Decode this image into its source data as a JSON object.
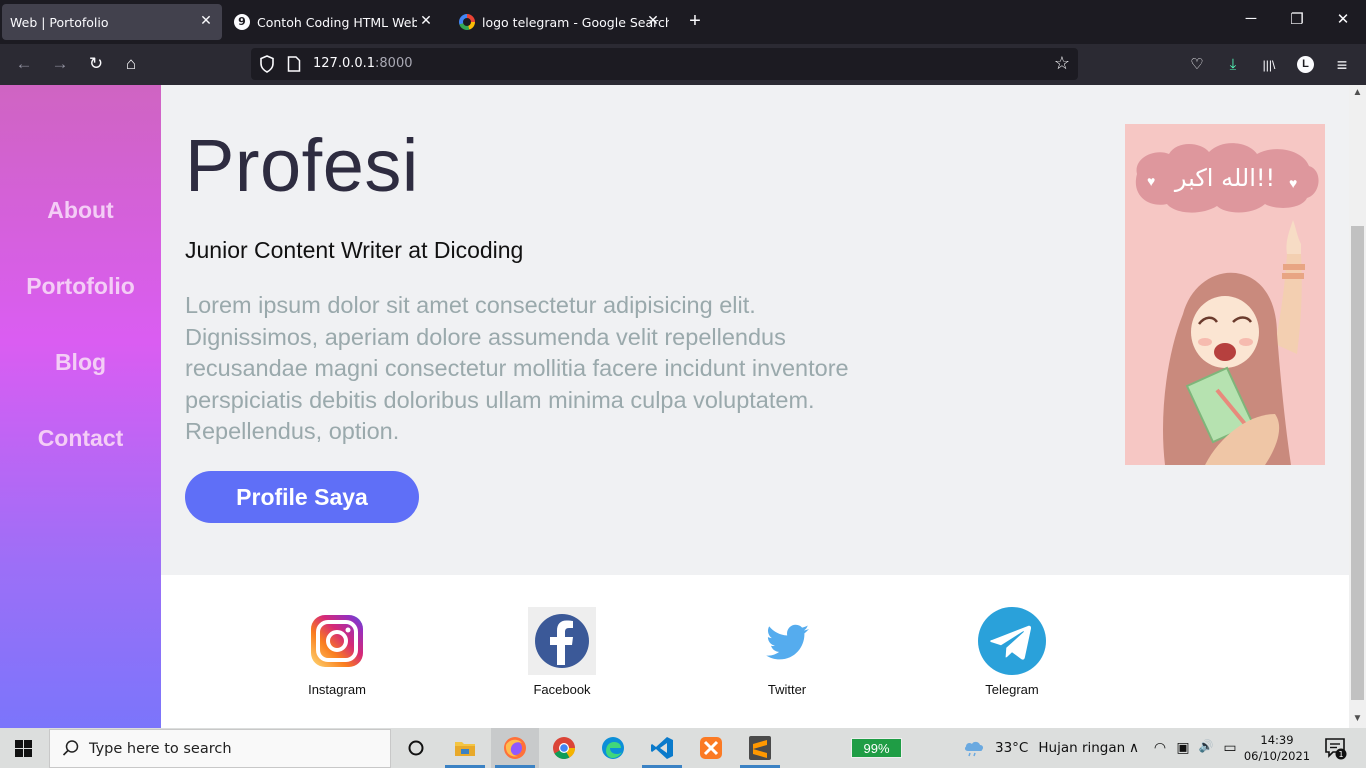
{
  "browser": {
    "tabs": [
      {
        "title": "Web | Portofolio",
        "active": true
      },
      {
        "title": "Contoh Coding HTML Website Po",
        "favicon": "9",
        "active": false
      },
      {
        "title": "logo telegram - Google Search",
        "active": false
      }
    ],
    "close_glyph": "✕",
    "new_tab_glyph": "+",
    "window": {
      "minimize": "─",
      "restore": "❐",
      "close": "✕"
    },
    "nav": {
      "back": "←",
      "forward": "→",
      "reload": "↻",
      "home": "⌂"
    },
    "url": {
      "host": "127.0.0.1",
      "port": ":8000"
    },
    "bookmark_star": "☆",
    "toolbar": {
      "pocket": "♡",
      "downloads": "⤓",
      "library": "|||\\",
      "account": "L",
      "menu": "≡"
    }
  },
  "page": {
    "sidebar": {
      "links": [
        "About",
        "Portofolio",
        "Blog",
        "Contact"
      ]
    },
    "hero": {
      "title": "Profesi",
      "subtitle": "Junior Content Writer at Dicoding",
      "paragraph": "Lorem ipsum dolor sit amet consectetur adipisicing elit. Dignissimos, aperiam dolore assumenda velit repellendus recusandae magni consectetur mollitia facere incidunt inventore perspiciatis debitis doloribus ullam minima culpa voluptatem. Repellendus, option.",
      "button": "Profile Saya",
      "image_text": "الله اكبر!!"
    },
    "social": [
      {
        "label": "Instagram",
        "icon": "instagram-icon"
      },
      {
        "label": "Facebook",
        "icon": "facebook-icon"
      },
      {
        "label": "Twitter",
        "icon": "twitter-icon"
      },
      {
        "label": "Telegram",
        "icon": "telegram-icon"
      }
    ],
    "scroll_up": "▲",
    "scroll_down": "▼"
  },
  "taskbar": {
    "search_placeholder": "Type here to search",
    "battery_indicator": "99%",
    "weather": {
      "temp": "33°C",
      "condition": "Hujan ringan"
    },
    "tray": {
      "chevron": "∧",
      "wifi": "◠",
      "meet": "▣",
      "volume": "🔊",
      "battery": "▭"
    },
    "clock": {
      "time": "14:39",
      "date": "06/10/2021"
    },
    "notifications": "1"
  },
  "colors": {
    "sidebar_gradient_top": "#cf64c2",
    "sidebar_gradient_bottom": "#7b75fb",
    "button_bg": "#5f6ff7",
    "paragraph": "#9aa9ac"
  }
}
